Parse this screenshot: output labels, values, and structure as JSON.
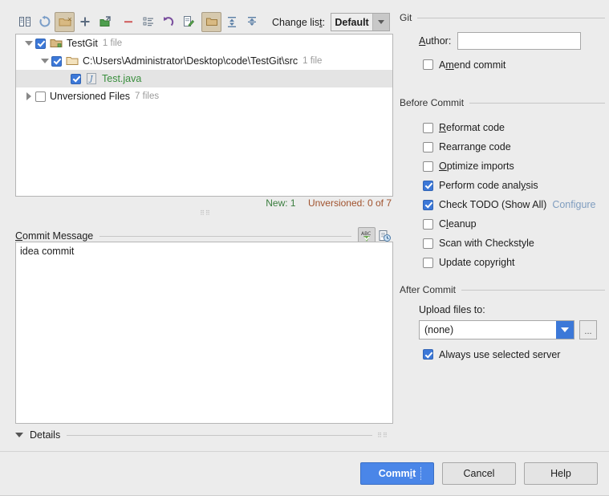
{
  "toolbar": {
    "buttons": [
      {
        "name": "show-diff-icon",
        "title": "Show Diff"
      },
      {
        "name": "refresh-icon",
        "title": "Refresh"
      },
      {
        "name": "delete-changelist-icon",
        "title": "Delete Changelist"
      },
      {
        "name": "add-icon",
        "title": "New Changelist"
      },
      {
        "name": "move-to-changelist-icon",
        "title": "Move to Another Changelist"
      },
      {
        "name": "remove-icon",
        "title": "Remove"
      },
      {
        "name": "list-icon",
        "title": "Show Details"
      },
      {
        "name": "revert-icon",
        "title": "Revert"
      },
      {
        "name": "edit-source-icon",
        "title": "Edit Source"
      },
      {
        "name": "group-by-directory-icon",
        "title": "Group by Directory"
      },
      {
        "name": "expand-all-icon",
        "title": "Expand All"
      },
      {
        "name": "collapse-all-icon",
        "title": "Collapse All"
      }
    ],
    "changelist_label": "Change list:",
    "changelist_value": "Default"
  },
  "tree": {
    "rows": [
      {
        "label": "TestGit",
        "count": "1 file",
        "checked": true,
        "expanded": true,
        "icon": "module-folder-icon",
        "indent": 0,
        "selected": false,
        "color": "default"
      },
      {
        "label": "C:\\Users\\Administrator\\Desktop\\code\\TestGit\\src",
        "count": "1 file",
        "checked": true,
        "expanded": true,
        "icon": "folder-icon",
        "indent": 1,
        "selected": false,
        "color": "default"
      },
      {
        "label": "Test.java",
        "count": "",
        "checked": true,
        "expanded": null,
        "icon": "java-file-icon",
        "indent": 2,
        "selected": true,
        "color": "green"
      },
      {
        "label": "Unversioned Files",
        "count": "7 files",
        "checked": false,
        "expanded": false,
        "icon": "none",
        "indent": 0,
        "selected": false,
        "color": "default"
      }
    ],
    "status_new": "New: 1",
    "status_unversioned": "Unversioned: 0 of 7"
  },
  "commit_message": {
    "label": "Commit Message",
    "label_mnemonic": "C",
    "value": "idea commit",
    "spellcheck_icon": "abc-spellcheck-icon",
    "history_icon": "message-history-icon"
  },
  "details": {
    "label": "Details",
    "expanded": true
  },
  "git": {
    "group_title": "Git",
    "author_label": "Author:",
    "author_mnemonic": "A",
    "author_value": "",
    "amend_label": "Amend commit",
    "amend_checked": false
  },
  "before_commit": {
    "group_title": "Before Commit",
    "items": [
      {
        "label": "Reformat code",
        "checked": false,
        "mnemonic": "R"
      },
      {
        "label": "Rearrange code",
        "checked": false,
        "mnemonic": "g"
      },
      {
        "label": "Optimize imports",
        "checked": false,
        "mnemonic": "O"
      },
      {
        "label": "Perform code analysis",
        "checked": true,
        "mnemonic": "y"
      },
      {
        "label": "Check TODO (Show All)",
        "checked": true,
        "mnemonic": "",
        "link": "Configure"
      },
      {
        "label": "Cleanup",
        "checked": false,
        "mnemonic": "l"
      },
      {
        "label": "Scan with Checkstyle",
        "checked": false,
        "mnemonic": ""
      },
      {
        "label": "Update copyright",
        "checked": false,
        "mnemonic": ""
      }
    ]
  },
  "after_commit": {
    "group_title": "After Commit",
    "upload_label": "Upload files to:",
    "upload_value": "(none)",
    "ellipsis_button": "...",
    "always_label": "Always use selected server",
    "always_checked": true
  },
  "buttons": {
    "commit": "Commit",
    "cancel": "Cancel",
    "help": "Help"
  },
  "colors": {
    "accent_blue": "#4a86e8",
    "checkbox_blue": "#3c78d8",
    "new_green": "#3a7d3e",
    "unversioned_brown": "#a0522d",
    "link_gray_blue": "#7f9dbf",
    "dialog_bg": "#ececec"
  }
}
